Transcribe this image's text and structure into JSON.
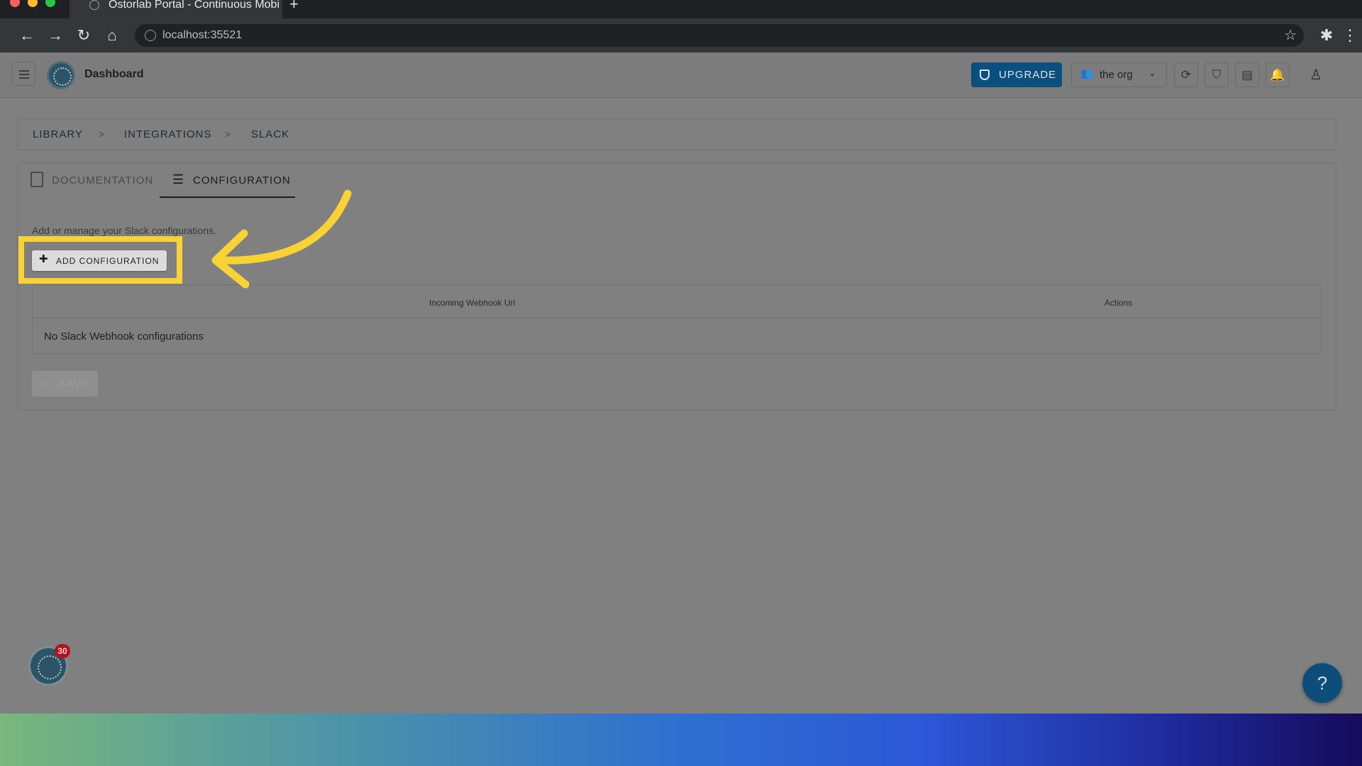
{
  "browser": {
    "tab_title": "Ostorlab Portal - Continuous Mobi",
    "url": "localhost:35521"
  },
  "header": {
    "title": "Dashboard",
    "upgrade_label": "UPGRADE",
    "org_label": "the org"
  },
  "breadcrumb": {
    "items": [
      "LIBRARY",
      "INTEGRATIONS",
      "SLACK"
    ],
    "separator": ">"
  },
  "tabs": {
    "documentation": "DOCUMENTATION",
    "configuration": "CONFIGURATION"
  },
  "content": {
    "help_text": "Add or manage your Slack configurations.",
    "add_button": "ADD CONFIGURATION",
    "table": {
      "columns": [
        "Incoming Webhook Url",
        "Actions"
      ],
      "empty_text": "No Slack Webhook configurations"
    },
    "save_button": "SAVE"
  },
  "floating": {
    "badge_count": "30",
    "help_label": "?"
  },
  "colors": {
    "highlight": "#f9d335",
    "primary": "#0b4f7e",
    "arrow": "#f9d335"
  }
}
